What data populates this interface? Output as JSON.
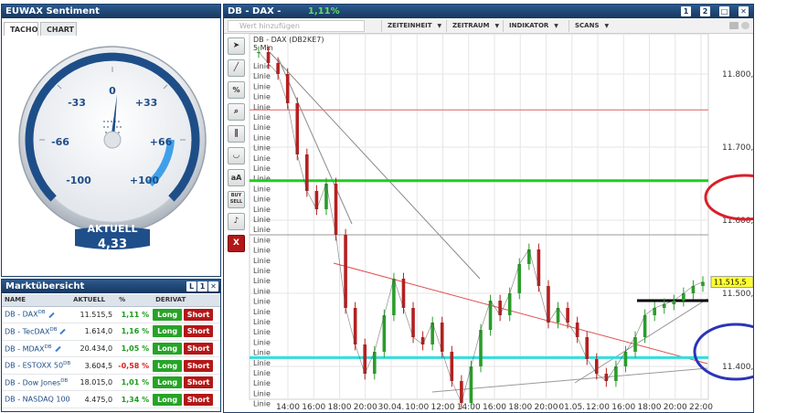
{
  "sentiment": {
    "title": "EUWAX Sentiment",
    "tabs": [
      "TACHO",
      "CHART"
    ],
    "gauge_labels": [
      "-100",
      "-66",
      "-33",
      "0",
      "+33",
      "+66",
      "+100"
    ],
    "current_label": "AKTUELL",
    "current_value": "4,33",
    "needle_value": 4.33
  },
  "market": {
    "title": "Marktübersicht",
    "buttons": [
      "L",
      "1"
    ],
    "columns": [
      "NAME",
      "AKTUELL",
      "%",
      "DERIVAT"
    ],
    "long_label": "Long",
    "short_label": "Short",
    "rows": [
      {
        "name": "DB - DAX",
        "sup": "DB",
        "value": "11.515,5",
        "pct": "1,11 %"
      },
      {
        "name": "DB - TecDAX",
        "sup": "DB",
        "value": "1.614,0",
        "pct": "1,16 %"
      },
      {
        "name": "DB - MDAX",
        "sup": "DB",
        "value": "20.434,0",
        "pct": "1,05 %"
      },
      {
        "name": "DB - ESTOXX 50",
        "sup": "DB",
        "value": "3.604,5",
        "pct": "-0,58 %"
      },
      {
        "name": "DB - Dow Jones",
        "sup": "DB",
        "value": "18.015,0",
        "pct": "1,01 %"
      },
      {
        "name": "DB - NASDAQ 100",
        "sup": "",
        "value": "4.475,0",
        "pct": "1,34 %"
      }
    ]
  },
  "chart_window": {
    "title": "DB - DAX -",
    "change": "1,11%",
    "buttons": [
      "1",
      "2"
    ],
    "search_placeholder": "Wert hinzufügen",
    "menus": [
      "ZEITEINHEIT",
      "ZEITRAUM",
      "INDIKATOR",
      "SCANS"
    ],
    "tools": [
      "cursor-icon",
      "line-icon",
      "fibonacci-icon",
      "zoom-icon",
      "channel-icon",
      "arc-icon",
      "text-icon",
      "buy-sell-icon",
      "sound-icon",
      "close-icon"
    ],
    "tool_labels": [
      "aA",
      "BUY SELL",
      "X"
    ]
  },
  "chart_data": {
    "type": "line",
    "title": "DB - DAX (DB2KE7)",
    "subtitle": "5 Min",
    "price_label": "11.515,5",
    "line_label": "Linie",
    "y_ticks": [
      "11.800,0",
      "11.700,0",
      "11.600,0",
      "11.500,0",
      "11.400,0"
    ],
    "ylim": [
      11355,
      11855
    ],
    "x_ticks": [
      "14:00",
      "16:00",
      "18:00",
      "20:00",
      "30.04.",
      "10:00",
      "12:00",
      "14:00",
      "16:00",
      "18:00",
      "20:00",
      "01.05.",
      "12:00",
      "16:00",
      "18:00",
      "20:00",
      "22:00"
    ],
    "series": [
      {
        "values": [
          11830,
          11815,
          11800,
          11760,
          11690,
          11640,
          11615,
          11650,
          11580,
          11480,
          11430,
          11390,
          11420,
          11470,
          11520,
          11480,
          11440,
          11430,
          11460,
          11420,
          11380,
          11350,
          11400,
          11450,
          11490,
          11470,
          11500,
          11540,
          11560,
          11510,
          11460,
          11480,
          11460,
          11440,
          11410,
          11390,
          11380,
          11400,
          11420,
          11440,
          11470,
          11480,
          11485,
          11490,
          11500,
          11510,
          11515.5
        ]
      }
    ],
    "horizontal_lines": [
      {
        "value": 11751,
        "color": "#e06060"
      },
      {
        "value": 11654,
        "color": "#22cc22"
      },
      {
        "value": 11580,
        "color": "#999999"
      },
      {
        "value": 11412,
        "color": "#33dddd"
      },
      {
        "value": 11490,
        "color": "#000000"
      }
    ],
    "annotation_circles": [
      {
        "color": "#d8202a"
      },
      {
        "color": "#2a35b8"
      }
    ]
  }
}
